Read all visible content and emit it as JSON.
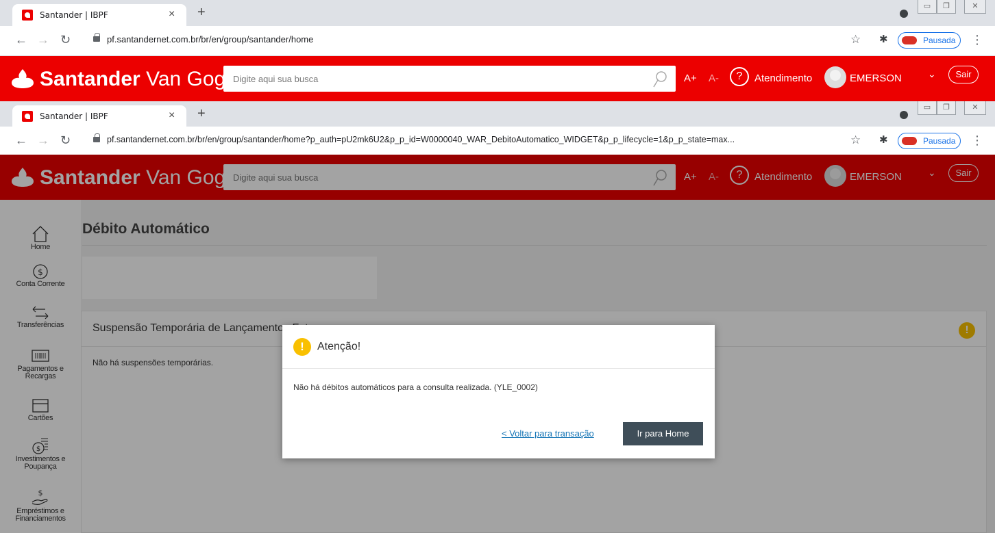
{
  "browser_top": {
    "tab_title": "Santander | IBPF",
    "tab_close": "×",
    "new_tab": "+",
    "url": "pf.santandernet.com.br/br/en/group/santander/home",
    "profile_label": "Pausada"
  },
  "browser_inner": {
    "tab_title": "Santander | IBPF",
    "tab_close": "×",
    "new_tab": "+",
    "url": "pf.santandernet.com.br/br/en/group/santander/home?p_auth=pU2mk6U2&p_p_id=W0000040_WAR_DebitoAutomatico_WIDGET&p_p_lifecycle=1&p_p_state=max...",
    "profile_label": "Pausada"
  },
  "header": {
    "brand": "Santander",
    "brand_suffix": "Van Gogh",
    "search_placeholder": "Digite aqui sua busca",
    "font_up": "A+",
    "font_down": "A-",
    "help_symbol": "?",
    "help_label": "Atendimento",
    "user_name": "EMERSON",
    "logout": "Sair",
    "brand_color": "#ec0000"
  },
  "sidebar": {
    "items": [
      {
        "label": "Home",
        "icon": "home-icon"
      },
      {
        "label": "Conta Corrente",
        "icon": "money-cycle-icon"
      },
      {
        "label": "Transferências",
        "icon": "transfer-arrows-icon"
      },
      {
        "label": "Pagamentos e Recargas",
        "icon": "barcode-icon"
      },
      {
        "label": "Cartões",
        "icon": "card-icon"
      },
      {
        "label": "Investimentos e Poupança",
        "icon": "coin-stack-icon"
      },
      {
        "label": "Empréstimos e Financiamentos",
        "icon": "hand-coin-icon"
      }
    ]
  },
  "page": {
    "title": "Débito Automático",
    "card_title": "Suspensão Temporária de Lançamentos Futuros",
    "card_empty": "Não há suspensões temporárias."
  },
  "modal": {
    "title": "Atenção!",
    "icon_symbol": "!",
    "message": "Não há débitos automáticos para a consulta realizada. (YLE_0002)",
    "link_label": "< Voltar para transação",
    "button_label": "Ir para Home",
    "warn_color": "#f9c000"
  }
}
